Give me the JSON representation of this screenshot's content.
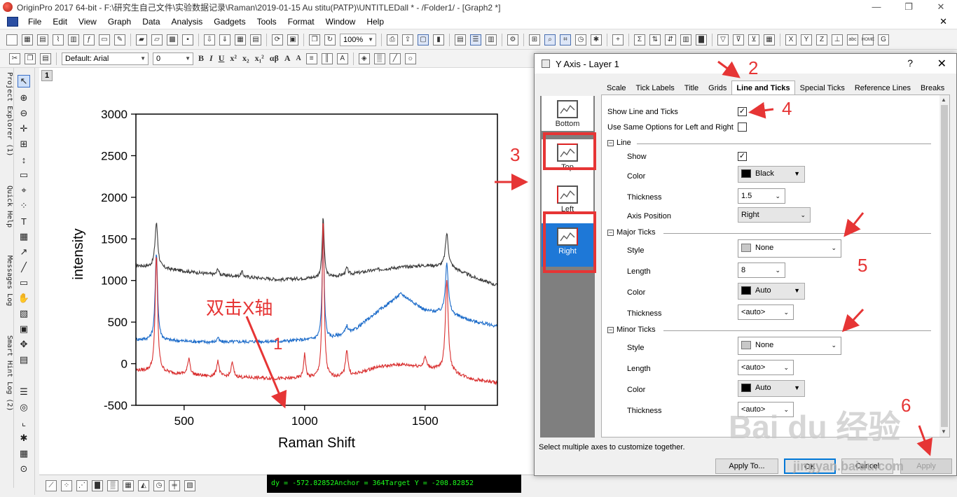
{
  "app": {
    "title": "OriginPro 2017 64-bit - F:\\研究生自己文件\\实验数据记录\\Raman\\2019-01-15 Au stitu(PATP)\\UNTITLEDall * - /Folder1/ - [Graph2 *]",
    "window_controls": [
      "—",
      "❐",
      "✕"
    ]
  },
  "menu": [
    "File",
    "Edit",
    "View",
    "Graph",
    "Data",
    "Analysis",
    "Gadgets",
    "Tools",
    "Format",
    "Window",
    "Help"
  ],
  "toolbar": {
    "zoom": "100%",
    "font_name": "Default: Arial",
    "font_size": "0",
    "format_buttons": [
      "B",
      "I",
      "U",
      "x²",
      "x₂",
      "x₁²",
      "αβ",
      "A",
      "A"
    ],
    "right_icons": [
      "abc",
      "HOME",
      "G"
    ]
  },
  "side_tabs": [
    "Project Explorer (1)",
    "Quick Help",
    "Messages Log",
    "Smart Hint Log (2)"
  ],
  "graph": {
    "layer_number": "1",
    "status_readout": "dy = -572.82852Anchor = 364Target Y = -208.82852"
  },
  "chart_data": {
    "type": "line",
    "xlabel": "Raman Shift",
    "ylabel": "intensity",
    "xlim": [
      300,
      1800
    ],
    "ylim": [
      -500,
      3000
    ],
    "xticks": [
      500,
      1000,
      1500
    ],
    "yticks": [
      -500,
      0,
      500,
      1000,
      1500,
      2000,
      2500,
      3000
    ],
    "baseline_x": [
      300,
      600,
      900,
      1100,
      1200,
      1300,
      1400,
      1500,
      1600,
      1700,
      1800
    ],
    "series": [
      {
        "color": "#3b3b3b",
        "baseline": [
          1180,
          1080,
          1010,
          1040,
          1080,
          1130,
          1160,
          1180,
          1170,
          1040,
          940
        ],
        "peaks": [
          [
            385,
            540,
            7
          ],
          [
            640,
            80,
            4
          ],
          [
            740,
            60,
            5
          ],
          [
            1077,
            720,
            5
          ],
          [
            1175,
            80,
            6
          ],
          [
            1590,
            400,
            7
          ]
        ]
      },
      {
        "color": "#1a6ac9",
        "baseline": [
          290,
          260,
          270,
          300,
          390,
          620,
          840,
          640,
          600,
          510,
          450
        ],
        "peaks": [
          [
            385,
            1060,
            6
          ],
          [
            640,
            60,
            4
          ],
          [
            1077,
            1300,
            5
          ],
          [
            1175,
            90,
            6
          ],
          [
            1590,
            620,
            7
          ]
        ]
      },
      {
        "color": "#d93030",
        "baseline": [
          -80,
          -150,
          -180,
          -170,
          -140,
          -40,
          -10,
          -40,
          -100,
          -190,
          -230
        ],
        "peaks": [
          [
            385,
            1410,
            6
          ],
          [
            520,
            200,
            6
          ],
          [
            640,
            190,
            6
          ],
          [
            700,
            170,
            6
          ],
          [
            1000,
            290,
            5
          ],
          [
            1077,
            1920,
            5
          ],
          [
            1175,
            320,
            6
          ],
          [
            1500,
            120,
            6
          ],
          [
            1590,
            1110,
            7
          ]
        ]
      }
    ]
  },
  "dialog": {
    "title": "Y Axis - Layer 1",
    "help": "?",
    "close": "✕",
    "tabs": [
      "Scale",
      "Tick Labels",
      "Title",
      "Grids",
      "Line and Ticks",
      "Special Ticks",
      "Reference Lines",
      "Breaks"
    ],
    "active_tab": "Line and Ticks",
    "axes": [
      "Bottom",
      "Top",
      "Left",
      "Right"
    ],
    "selected_axis": "Right",
    "show_line_and_ticks": {
      "label": "Show Line and Ticks",
      "checked": true
    },
    "same_options": {
      "label": "Use Same Options for Left and Right",
      "checked": false
    },
    "line": {
      "section": "Line",
      "show_label": "Show",
      "show_checked": true,
      "color_label": "Color",
      "color_value": "Black",
      "color_hex": "#000000",
      "thickness_label": "Thickness",
      "thickness_value": "1.5",
      "position_label": "Axis Position",
      "position_value": "Right"
    },
    "major": {
      "section": "Major Ticks",
      "style_label": "Style",
      "style_value": "None",
      "style_swatch": "#c8c8c8",
      "length_label": "Length",
      "length_value": "8",
      "color_label": "Color",
      "color_value": "Auto",
      "color_hex": "#000000",
      "thickness_label": "Thickness",
      "thickness_value": "<auto>"
    },
    "minor": {
      "section": "Minor Ticks",
      "style_label": "Style",
      "style_value": "None",
      "style_swatch": "#c8c8c8",
      "length_label": "Length",
      "length_value": "<auto>",
      "color_label": "Color",
      "color_value": "Auto",
      "color_hex": "#000000",
      "thickness_label": "Thickness",
      "thickness_value": "<auto>"
    },
    "footer_hint": "Select multiple axes to customize together.",
    "buttons": {
      "apply_to": "Apply To...",
      "ok": "OK",
      "cancel": "Cancel",
      "apply": "Apply"
    }
  },
  "annotations": {
    "numbers": [
      "1",
      "2",
      "3",
      "4",
      "5",
      "6"
    ],
    "double_click_text": "双击X轴",
    "color": "#e63535"
  },
  "watermark": {
    "logo": "Bai du 经验",
    "url": "jingyan.baidu.com"
  }
}
